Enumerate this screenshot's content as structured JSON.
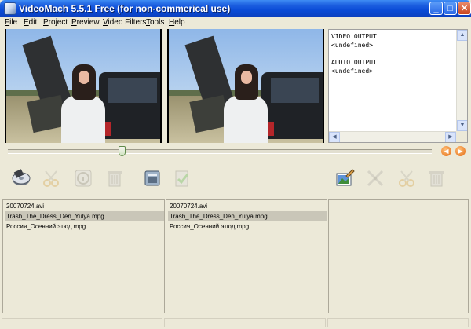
{
  "window": {
    "title": "VideoMach 5.5.1 Free (for non-commerical use)"
  },
  "title_buttons": {
    "minimize": "_",
    "maximize": "□",
    "close": "✕"
  },
  "menu": [
    "File",
    "Edit",
    "Project",
    "Preview",
    "Video Filters",
    "Tools",
    "Help"
  ],
  "info_panel": {
    "text": "VIDEO OUTPUT\n<undefined>\n\nAUDIO OUTPUT\n<undefined>",
    "scroll_up": "▲",
    "scroll_down": "▼",
    "scroll_left": "◀",
    "scroll_right": "▶"
  },
  "seek": {
    "position_fraction": 0.27
  },
  "nav_buttons": {
    "prev": "◀",
    "next": "▶"
  },
  "accent_colors": {
    "titlebar": "#0a4bd6",
    "nav_button": "#e36a10",
    "selection": "#c9c6b8"
  },
  "toolbar_icons": [
    "disc-icon",
    "scissors-icon",
    "info-icon",
    "trash-icon",
    "device-icon",
    "clipboard-icon",
    "image-edit-icon",
    "cross-tools-icon",
    "scissors-icon",
    "trash-icon"
  ],
  "source_list": {
    "items": [
      {
        "name": "20070724.avi",
        "selected": false
      },
      {
        "name": "Trash_The_Dress_Den_Yulya.mpg",
        "selected": true
      },
      {
        "name": "Россия_Осенний этюд.mpg",
        "selected": false
      }
    ]
  },
  "output_list": {
    "items": [
      {
        "name": "20070724.avi",
        "selected": false
      },
      {
        "name": "Trash_The_Dress_Den_Yulya.mpg",
        "selected": true
      },
      {
        "name": "Россия_Осенний этюд.mpg",
        "selected": false
      }
    ]
  }
}
